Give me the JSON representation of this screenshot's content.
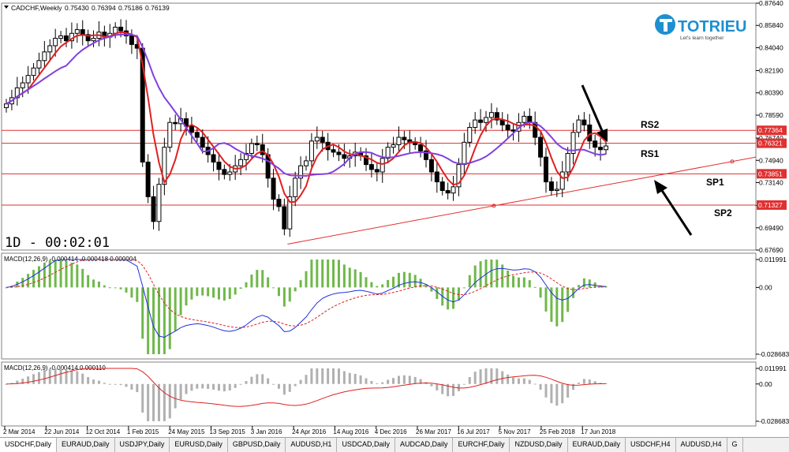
{
  "chart_data": {
    "type": "candlestick",
    "symbol_line": {
      "symbol": "CADCHF,Weekly",
      "ohlc": [
        "0.75430",
        "0.76394",
        "0.75186",
        "0.76139"
      ]
    },
    "timer": "1D - 00:02:01",
    "price_axis": {
      "ticks": [
        "0.87640",
        "0.85840",
        "0.84040",
        "0.82190",
        "0.80390",
        "0.78590",
        "0.76740",
        "0.74940",
        "0.73140",
        "0.71290",
        "0.69490",
        "0.67690"
      ],
      "range": [
        0.6769,
        0.8764
      ]
    },
    "x_axis_labels": [
      "2 Mar 2014",
      "22 Jun 2014",
      "12 Oct 2014",
      "1 Feb 2015",
      "24 May 2015",
      "13 Sep 2015",
      "3 Jan 2016",
      "24 Apr 2016",
      "14 Aug 2016",
      "4 Dec 2016",
      "26 Mar 2017",
      "16 Jul 2017",
      "5 Nov 2017",
      "25 Feb 2018",
      "17 Jun 2018"
    ],
    "close_series": [
      0.795,
      0.8,
      0.808,
      0.812,
      0.818,
      0.824,
      0.83,
      0.837,
      0.842,
      0.848,
      0.85,
      0.846,
      0.852,
      0.855,
      0.851,
      0.846,
      0.848,
      0.853,
      0.849,
      0.852,
      0.857,
      0.854,
      0.85,
      0.843,
      0.84,
      0.748,
      0.72,
      0.7,
      0.73,
      0.76,
      0.78,
      0.779,
      0.783,
      0.777,
      0.772,
      0.768,
      0.76,
      0.754,
      0.748,
      0.742,
      0.738,
      0.74,
      0.745,
      0.75,
      0.755,
      0.763,
      0.762,
      0.754,
      0.735,
      0.718,
      0.712,
      0.694,
      0.72,
      0.735,
      0.745,
      0.749,
      0.765,
      0.768,
      0.764,
      0.758,
      0.756,
      0.754,
      0.751,
      0.753,
      0.756,
      0.753,
      0.746,
      0.742,
      0.74,
      0.751,
      0.76,
      0.762,
      0.768,
      0.766,
      0.764,
      0.762,
      0.757,
      0.75,
      0.74,
      0.732,
      0.725,
      0.723,
      0.728,
      0.746,
      0.764,
      0.776,
      0.782,
      0.78,
      0.784,
      0.788,
      0.782,
      0.778,
      0.774,
      0.773,
      0.78,
      0.785,
      0.78,
      0.768,
      0.752,
      0.732,
      0.725,
      0.726,
      0.74,
      0.755,
      0.772,
      0.782,
      0.778,
      0.765,
      0.76,
      0.758,
      0.761
    ],
    "moving_averages": [
      {
        "color": "#e02020",
        "period": 5
      },
      {
        "color": "#8040e0",
        "period": 12
      }
    ],
    "horizontal_levels": [
      {
        "value": 0.77364,
        "label": "0.77364"
      },
      {
        "value": 0.76321,
        "label": "0.76321"
      },
      {
        "value": 0.73851,
        "label": "0.73851"
      },
      {
        "value": 0.71327,
        "label": "0.71327"
      }
    ],
    "trendline": {
      "from_price": 0.6817,
      "to_price": 0.752
    },
    "annotations": [
      "RS2",
      "RS1",
      "SP1",
      "SP2"
    ],
    "brand": {
      "name": "TOTRIEU",
      "tagline": "Let's learn together",
      "color": "#1e8fd0"
    },
    "macd1": {
      "label": "MACD(12,26,9) -0.000414 -0.000418 0.000004",
      "ticks": [
        "0.011991",
        "0.00",
        "-0.028683"
      ],
      "histogram_color": "#6fb84a",
      "line_colors": [
        "#2030e0",
        "#e02020"
      ]
    },
    "macd2": {
      "label": "MACD(12,26,9) -0.000414 0.000110",
      "ticks": [
        "0.011991",
        "0.00",
        "-0.028683"
      ],
      "histogram_color": "#b0b0b0",
      "line_colors": [
        "#e02020"
      ]
    },
    "colors": {
      "candle": "#000000",
      "level": "#e03030",
      "grid": "#c0c0c0"
    }
  },
  "tabs": [
    "USDCHF,Daily",
    "EURAUD,Daily",
    "USDJPY,Daily",
    "EURUSD,Daily",
    "GBPUSD,Daily",
    "AUDUSD,H1",
    "USDCAD,Daily",
    "AUDCAD,Daily",
    "EURCHF,Daily",
    "NZDUSD,Daily",
    "EURAUD,Daily",
    "USDCHF,H4",
    "AUDUSD,H4",
    "G"
  ]
}
